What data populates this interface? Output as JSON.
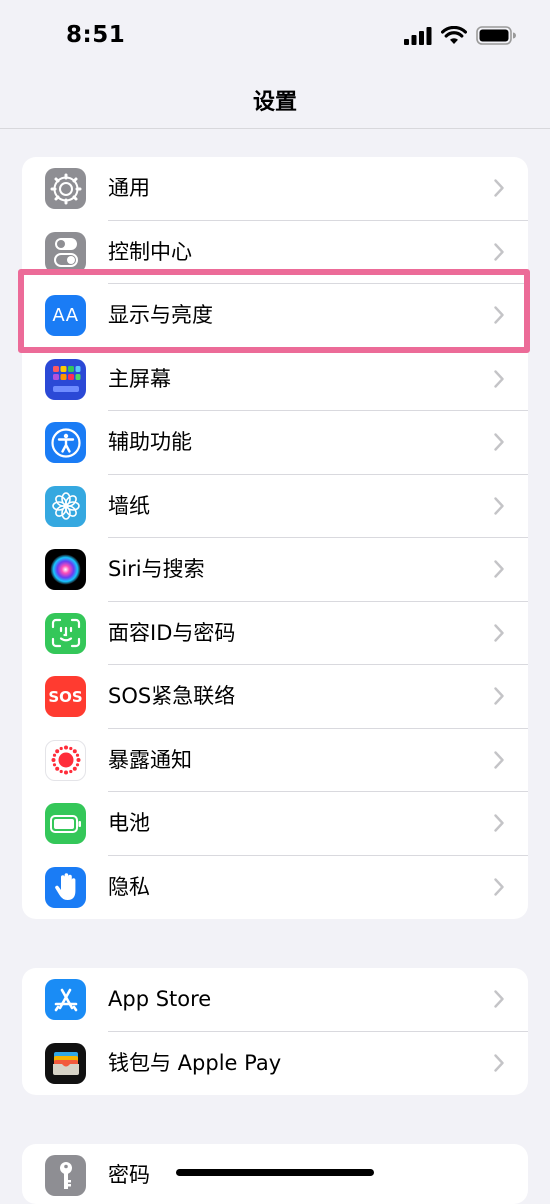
{
  "status_bar": {
    "time": "8:51"
  },
  "nav": {
    "title": "设置"
  },
  "groups": [
    {
      "items": [
        {
          "label": "通用",
          "icon": "gear-icon"
        },
        {
          "label": "控制中心",
          "icon": "toggles-icon"
        },
        {
          "label": "显示与亮度",
          "icon": "display-brightness-icon",
          "icon_text": "AA"
        },
        {
          "label": "主屏幕",
          "icon": "home-screen-icon"
        },
        {
          "label": "辅助功能",
          "icon": "accessibility-icon"
        },
        {
          "label": "墙纸",
          "icon": "wallpaper-flower-icon"
        },
        {
          "label": "Siri与搜索",
          "icon": "siri-icon"
        },
        {
          "label": "面容ID与密码",
          "icon": "face-id-icon"
        },
        {
          "label": "SOS紧急联络",
          "icon": "sos-icon",
          "icon_text": "SOS"
        },
        {
          "label": "暴露通知",
          "icon": "exposure-notification-icon"
        },
        {
          "label": "电池",
          "icon": "battery-icon"
        },
        {
          "label": "隐私",
          "icon": "privacy-hand-icon"
        }
      ]
    },
    {
      "items": [
        {
          "label": "App Store",
          "icon": "app-store-icon"
        },
        {
          "label": "钱包与 Apple Pay",
          "icon": "wallet-icon"
        }
      ]
    },
    {
      "items": [
        {
          "label": "密码",
          "icon": "key-icon"
        }
      ]
    }
  ],
  "colors": {
    "background": "#f2f2f7",
    "highlight": "#ec6b98",
    "gray_icon": "#8e8e93",
    "blue_icon": "#1a7cf5",
    "green_icon": "#34c759",
    "red_icon": "#ff3b30"
  }
}
